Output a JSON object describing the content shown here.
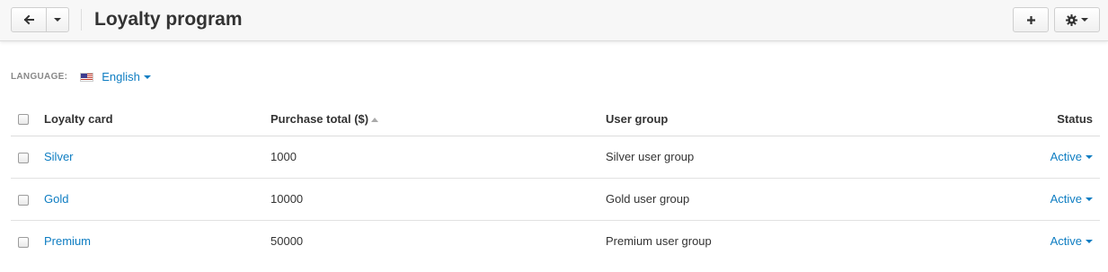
{
  "header": {
    "title": "Loyalty program",
    "back_icon": "arrow-left-icon",
    "add_icon": "plus-icon",
    "settings_icon": "gear-icon"
  },
  "language": {
    "label": "LANGUAGE:",
    "value": "English",
    "flag": "us-flag-icon"
  },
  "table": {
    "columns": [
      "Loyalty card",
      "Purchase total ($)",
      "User group",
      "Status"
    ],
    "rows": [
      {
        "card": "Silver",
        "total": "1000",
        "group": "Silver user group",
        "status": "Active"
      },
      {
        "card": "Gold",
        "total": "10000",
        "group": "Gold user group",
        "status": "Active"
      },
      {
        "card": "Premium",
        "total": "50000",
        "group": "Premium user group",
        "status": "Active"
      }
    ]
  },
  "colors": {
    "link": "#0e7dc2",
    "header_bg": "#f7f7f7"
  }
}
